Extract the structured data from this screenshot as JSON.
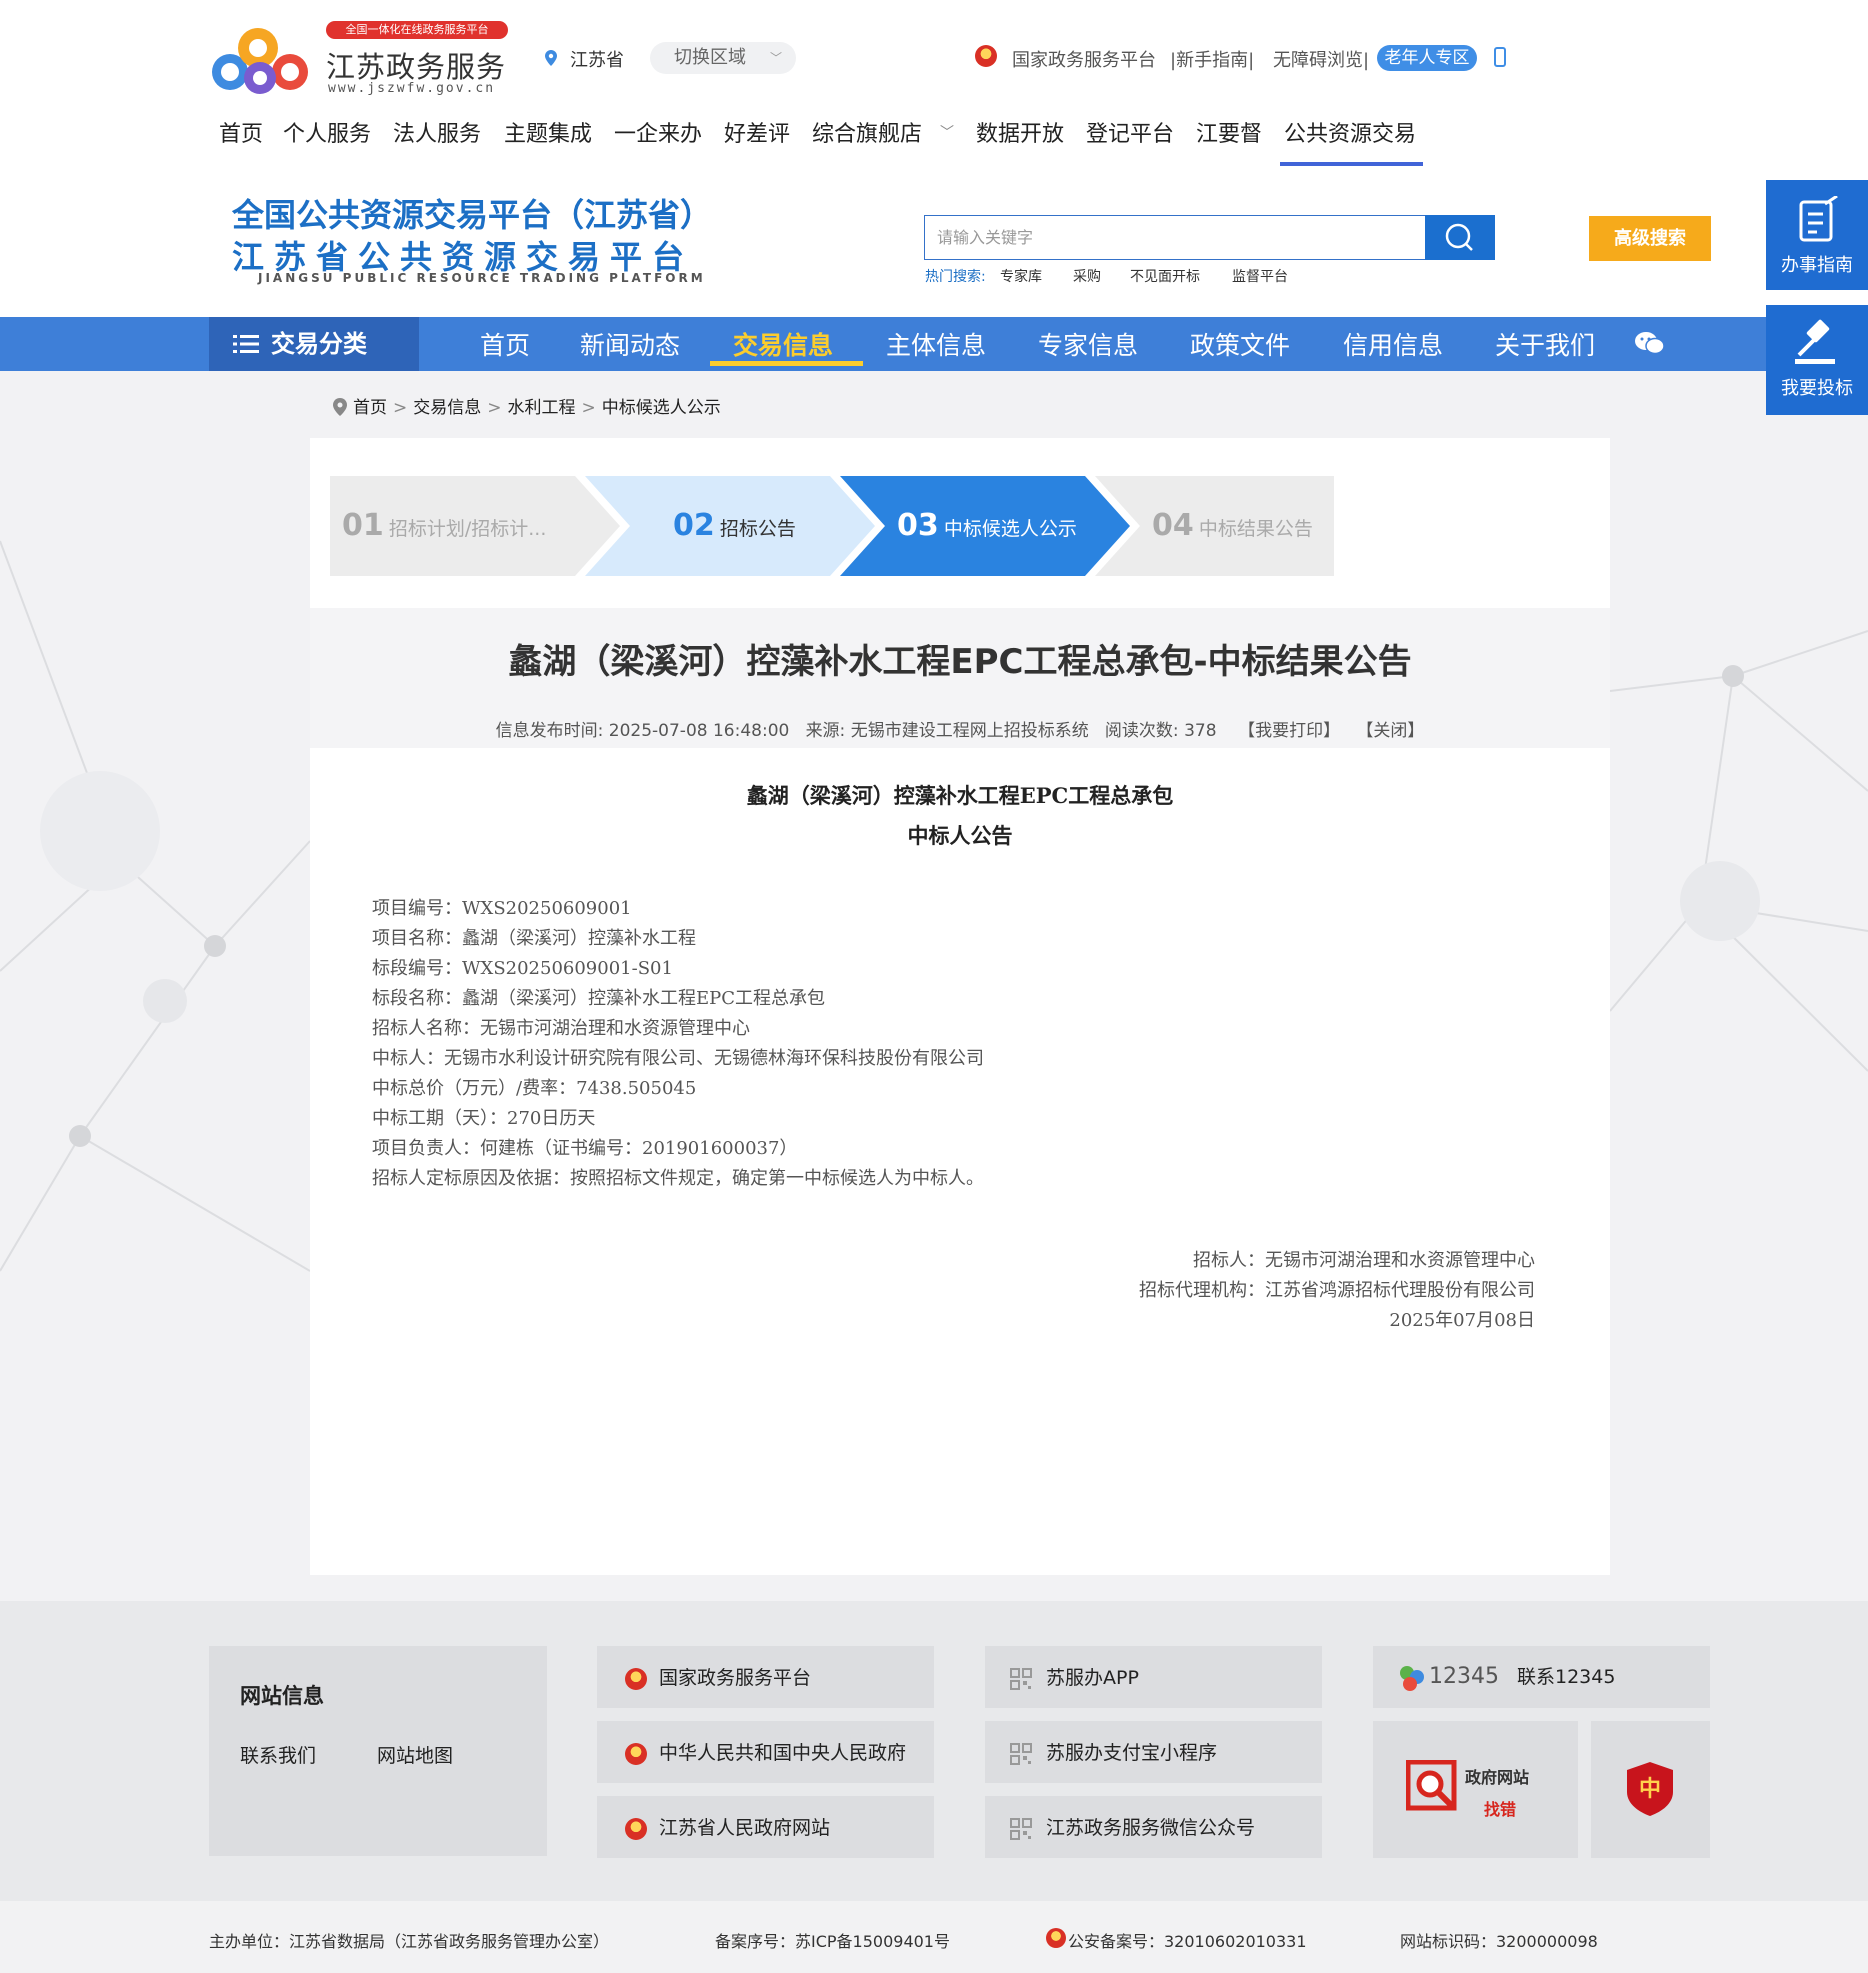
{
  "header": {
    "badge": "全国一体化在线政务服务平台",
    "site_title": "江苏政务服务",
    "site_url": "www.jszwfw.gov.cn",
    "region": "江苏省",
    "switch_region": "切换区域",
    "top_links": [
      "国家政务服务平台",
      "|新手指南|",
      "无障碍浏览|"
    ],
    "elder_zone": "老年人专区",
    "nav": [
      "首页",
      "个人服务",
      "法人服务",
      "主题集成",
      "一企来办",
      "好差评",
      "综合旗舰店",
      "数据开放",
      "登记平台",
      "江要督",
      "公共资源交易"
    ],
    "nav_active_index": 10
  },
  "platform": {
    "title1": "全国公共资源交易平台（江苏省）",
    "title2": "江苏省公共资源交易平台",
    "title_en": "JIANGSU PUBLIC RESOURCE TRADING PLATFORM",
    "search_placeholder": "请输入关键字",
    "hot_label": "热门搜索:",
    "hot_items": [
      "专家库",
      "采购",
      "不见面开标",
      "监督平台"
    ],
    "advanced_search": "高级搜索"
  },
  "bluenav": {
    "category": "交易分类",
    "items": [
      "首页",
      "新闻动态",
      "交易信息",
      "主体信息",
      "专家信息",
      "政策文件",
      "信用信息",
      "关于我们"
    ],
    "active_index": 2
  },
  "floating": {
    "guide": "办事指南",
    "bid": "我要投标"
  },
  "breadcrumb": [
    "首页",
    "交易信息",
    "水利工程",
    "中标候选人公示"
  ],
  "steps": [
    {
      "num": "01",
      "label": "招标计划/招标计..."
    },
    {
      "num": "02",
      "label": "招标公告"
    },
    {
      "num": "03",
      "label": "中标候选人公示"
    },
    {
      "num": "04",
      "label": "中标结果公告"
    }
  ],
  "article": {
    "title": "蠡湖（梁溪河）控藻补水工程EPC工程总承包-中标结果公告",
    "meta_time_label": "信息发布时间:",
    "meta_time": "2025-07-08 16:48:00",
    "meta_source_label": "来源:",
    "meta_source": "无锡市建设工程网上招投标系统",
    "meta_reads_label": "阅读次数:",
    "meta_reads": "378",
    "print": "【我要打印】",
    "close": "【关闭】",
    "doc_title": "蠡湖（梁溪河）控藻补水工程EPC工程总承包",
    "doc_subtitle": "中标人公告",
    "lines": [
      "项目编号：WXS20250609001",
      "项目名称：蠡湖（梁溪河）控藻补水工程",
      "标段编号：WXS20250609001-S01",
      "标段名称：蠡湖（梁溪河）控藻补水工程EPC工程总承包",
      "招标人名称：无锡市河湖治理和水资源管理中心",
      "中标人：无锡市水利设计研究院有限公司、无锡德林海环保科技股份有限公司",
      "中标总价（万元）/费率：7438.505045",
      "中标工期（天）：270日历天",
      "项目负责人：何建栋（证书编号：201901600037）",
      "招标人定标原因及依据：按照招标文件规定，确定第一中标候选人为中标人。"
    ],
    "sign": [
      "招标人：无锡市河湖治理和水资源管理中心",
      "招标代理机构：江苏省鸿源招标代理股份有限公司",
      "2025年07月08日"
    ]
  },
  "footer": {
    "site_info": "网站信息",
    "contact": "联系我们",
    "sitemap": "网站地图",
    "col2": [
      "国家政务服务平台",
      "中华人民共和国中央人民政府",
      "江苏省人民政府网站"
    ],
    "col3": [
      "苏服办APP",
      "苏服办支付宝小程序",
      "江苏政务服务微信公众号"
    ],
    "hotline_logo": "12345",
    "hotline": "联系12345",
    "gov_error_line1": "政府网站",
    "gov_error_line2": "找错",
    "bottom": {
      "host": "主办单位：江苏省数据局（江苏省政务服务管理办公室）",
      "icp": "备案序号：苏ICP备15009401号",
      "police": "公安备案号：32010602010331",
      "site_code": "网站标识码：3200000098"
    }
  }
}
